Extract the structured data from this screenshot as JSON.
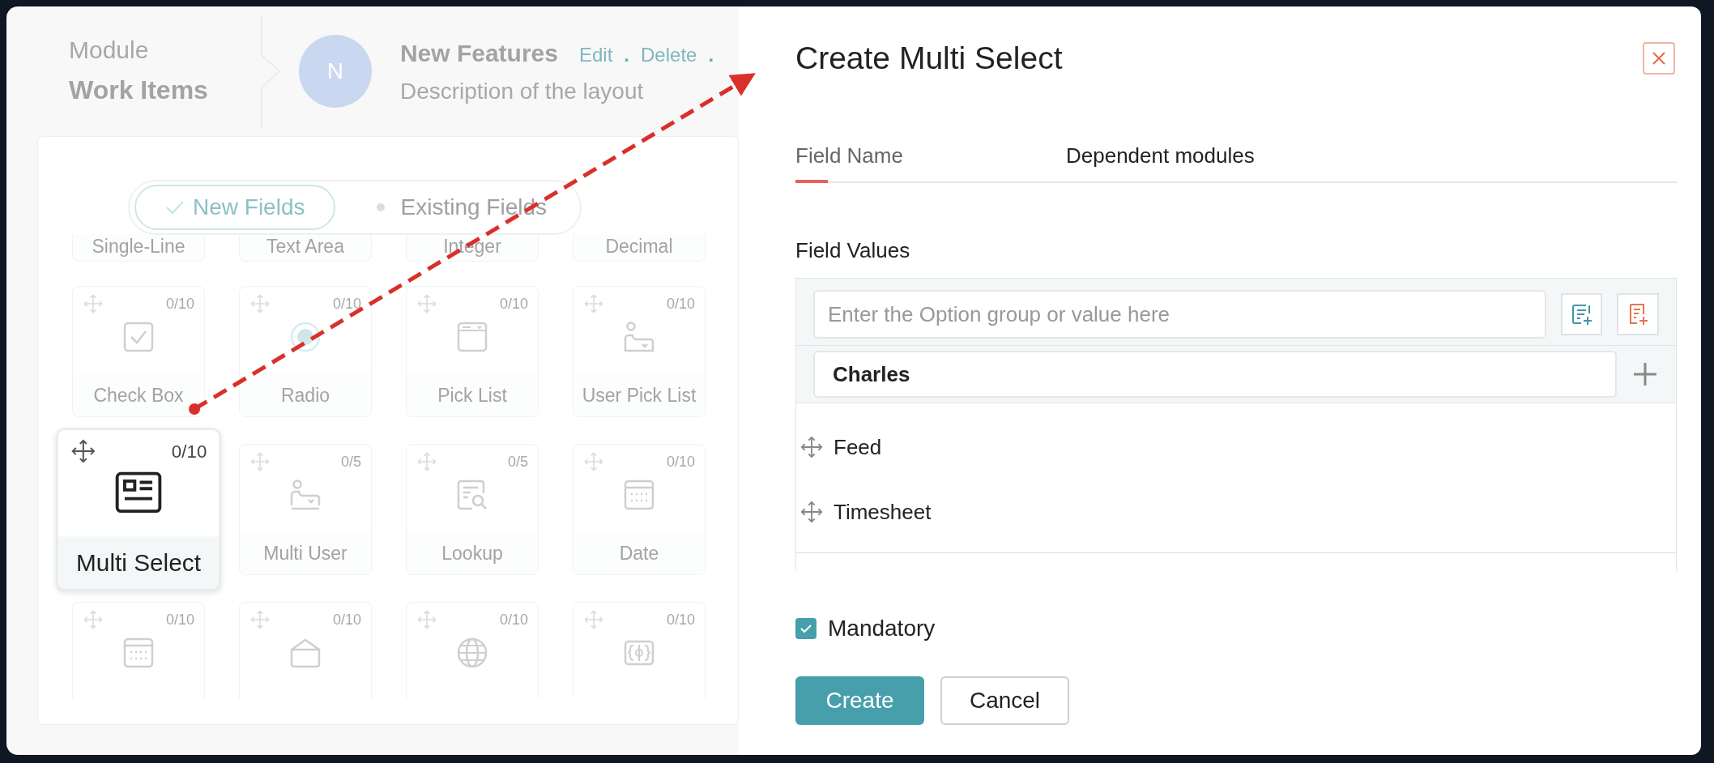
{
  "layout_header": {
    "module_label": "Module",
    "module_name": "Work Items",
    "avatar_letter": "N",
    "layout_name": "New Features",
    "actions": [
      "Edit",
      "Delete"
    ],
    "separator": ".",
    "description": "Description of the layout"
  },
  "field_toggle": [
    {
      "label": "New Fields",
      "selected": true
    },
    {
      "label": "Existing Fields",
      "selected": false
    }
  ],
  "partial_tiles": [
    "Single-Line",
    "Text Area",
    "Integer",
    "Decimal"
  ],
  "tiles": [
    {
      "kind": "checkbox",
      "count": "0/10",
      "label": "Check Box",
      "selected": false
    },
    {
      "kind": "radio",
      "count": "0/10",
      "label": "Radio",
      "selected": false
    },
    {
      "kind": "picklist",
      "count": "0/10",
      "label": "Pick List",
      "selected": false
    },
    {
      "kind": "userpicklist",
      "count": "0/10",
      "label": "User Pick List",
      "selected": false
    },
    {
      "kind": "multiselect",
      "count": "0/10",
      "label": "Multi Select",
      "selected": true
    },
    {
      "kind": "multiuser",
      "count": "0/5",
      "label": "Multi User",
      "selected": false
    },
    {
      "kind": "lookup",
      "count": "0/5",
      "label": "Lookup",
      "selected": false
    },
    {
      "kind": "date",
      "count": "0/10",
      "label": "Date",
      "selected": false
    },
    {
      "kind": "date",
      "count": "0/10",
      "selected": false
    },
    {
      "kind": "envelope",
      "count": "0/10",
      "selected": false
    },
    {
      "kind": "globe",
      "count": "0/10",
      "selected": false
    },
    {
      "kind": "currency",
      "count": "0/10",
      "selected": false
    }
  ],
  "dialog": {
    "title": "Create Multi Select",
    "field_name": {
      "label": "Field Name",
      "value": "Dependent modules"
    },
    "field_values": {
      "label": "Field Values",
      "placeholder": "Enter the Option group or value here",
      "group_value": "Charles",
      "options": [
        "Feed",
        "Timesheet"
      ]
    },
    "mandatory": {
      "label": "Mandatory",
      "checked": true
    },
    "buttons": [
      {
        "label": "Create",
        "kind": "primary"
      },
      {
        "label": "Cancel",
        "kind": "secondary"
      }
    ]
  }
}
